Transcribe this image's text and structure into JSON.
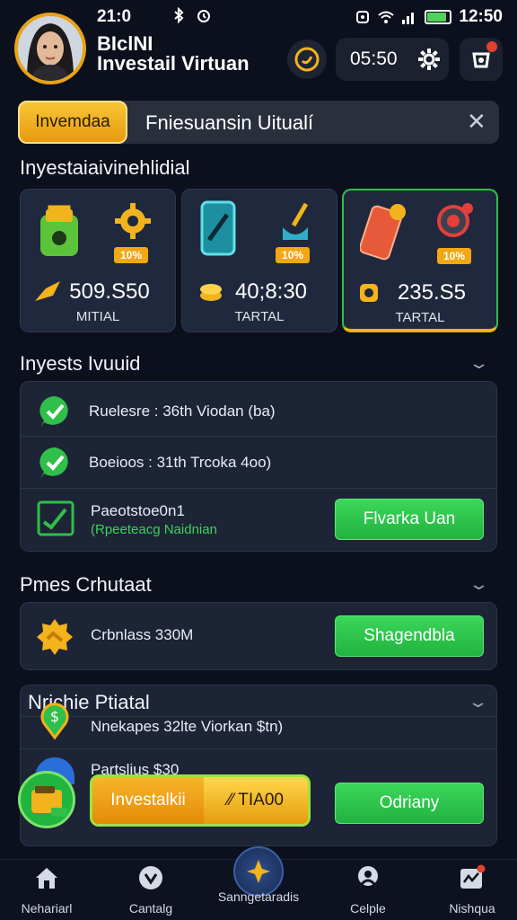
{
  "status_bar": {
    "time_left": "21:0",
    "time_right": "12:50"
  },
  "header": {
    "title_line1": "BIclNI",
    "title_line2": "Investail Virtuan",
    "timer": "05:50"
  },
  "search": {
    "chip_label": "Invemdaa",
    "query": "Fniesuansin Uitualí"
  },
  "section1": {
    "title": "Inyestaiaivinehlidial"
  },
  "cards": [
    {
      "badge": "10%",
      "amount": "509.S50",
      "label": "MITIAL"
    },
    {
      "badge": "10%",
      "amount": "40;8:30",
      "label": "TARTAL"
    },
    {
      "badge": "10%",
      "amount": "235.S5",
      "label": "TARTAL"
    }
  ],
  "section2": {
    "title": "Inyests Ivuuid",
    "rows": [
      {
        "text": "Ruelesre : 36th Viodan (ba)"
      },
      {
        "text": "Boeioos : 31th Trcoka 4oo)"
      },
      {
        "text": "Paeotstoe0n1",
        "sub": "(Rpeeteacg Naidnian",
        "button": "Flvarka Uan"
      }
    ]
  },
  "section3": {
    "title": "Pmes Crhutaat",
    "row_text": "Crbnlass 330M",
    "button": "Shagendbla"
  },
  "section4": {
    "title": "Nrichie Ptiatal",
    "row1": "Nnekapes 32lte Viorkan $tn)",
    "row2": "Partslius $30",
    "button": "Odriany"
  },
  "overlay": {
    "left_label": "Investalkii",
    "right_label": "⁄⁄ TIA00"
  },
  "nav": [
    {
      "label": "Nehariarl"
    },
    {
      "label": "Cantalg"
    },
    {
      "label": "Sanngetaradis"
    },
    {
      "label": "Celple"
    },
    {
      "label": "Nishqua"
    }
  ],
  "colors": {
    "background": "#0b101c",
    "accent_orange": "#f1a814",
    "accent_green": "#2fbf4a",
    "panel": "#1d2436"
  }
}
